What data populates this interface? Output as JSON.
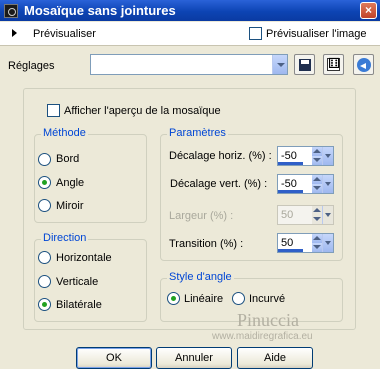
{
  "window": {
    "title": "Mosaïque sans jointures",
    "close_label": "×"
  },
  "preview_bar": {
    "preview_label": "Prévisualiser",
    "preview_image_label": "Prévisualiser l'image",
    "preview_image_checked": false
  },
  "settings": {
    "label": "Réglages",
    "preset_value": ""
  },
  "show_mosaic_preview": {
    "label": "Afficher l'aperçu de la mosaïque",
    "checked": false
  },
  "method": {
    "title": "Méthode",
    "options": [
      {
        "label": "Bord",
        "selected": false
      },
      {
        "label": "Angle",
        "selected": true
      },
      {
        "label": "Miroir",
        "selected": false
      }
    ]
  },
  "direction": {
    "title": "Direction",
    "options": [
      {
        "label": "Horizontale",
        "selected": false
      },
      {
        "label": "Verticale",
        "selected": false
      },
      {
        "label": "Bilatérale",
        "selected": true
      }
    ]
  },
  "parameters": {
    "title": "Paramètres",
    "fields": [
      {
        "label": "Décalage horiz. (%) :",
        "value": "-50",
        "enabled": true
      },
      {
        "label": "Décalage vert. (%) :",
        "value": "-50",
        "enabled": true
      },
      {
        "label": "Largeur (%) :",
        "value": "50",
        "enabled": false
      },
      {
        "label": "Transition (%) :",
        "value": "50",
        "enabled": true
      }
    ]
  },
  "angle_style": {
    "title": "Style d'angle",
    "options": [
      {
        "label": "Linéaire",
        "selected": true
      },
      {
        "label": "Incurvé",
        "selected": false
      }
    ]
  },
  "watermark": {
    "name": "Pinuccia",
    "url": "www.maidiregrafica.eu"
  },
  "buttons": {
    "ok": "OK",
    "cancel": "Annuler",
    "help": "Aide"
  },
  "colors": {
    "title_bar": "#0d44b4",
    "group_title": "#0046d5",
    "dialog_bg": "#ece9d8",
    "selected_radio": "#21a121"
  }
}
